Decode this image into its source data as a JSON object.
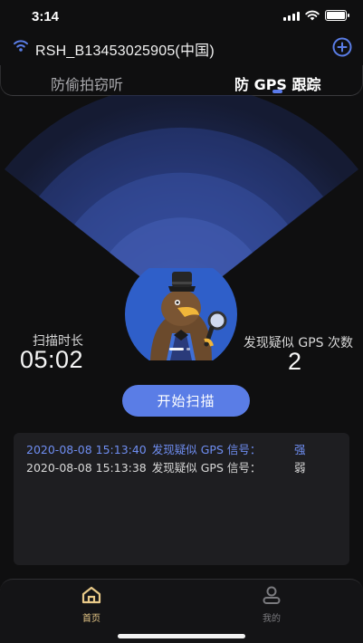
{
  "status_bar": {
    "time": "3:14"
  },
  "network": {
    "name": "RSH_B13453025905(中国)"
  },
  "tabs": [
    {
      "label": "防偷拍窃听",
      "active": false
    },
    {
      "label": "防 GPS 跟踪",
      "active": true
    }
  ],
  "stats": {
    "duration_label": "扫描时长",
    "duration_value": "05:02",
    "count_label": "发现疑似 GPS 次数",
    "count_value": "2"
  },
  "scan_button": {
    "label": "开始扫描"
  },
  "log": [
    {
      "time": "2020-08-08 15:13:40",
      "text": "发现疑似 GPS 信号：",
      "level": "强",
      "highlight": true
    },
    {
      "time": "2020-08-08 15:13:38",
      "text": "发现疑似 GPS 信号：",
      "level": "弱",
      "highlight": false
    }
  ],
  "bottom_nav": [
    {
      "label": "首页",
      "icon": "home-icon",
      "active": true
    },
    {
      "label": "我的",
      "icon": "profile-icon",
      "active": false
    }
  ],
  "colors": {
    "accent": "#5a7de6",
    "active_nav": "#e8c988",
    "background": "#0f0f10",
    "panel": "#1e1e21"
  }
}
